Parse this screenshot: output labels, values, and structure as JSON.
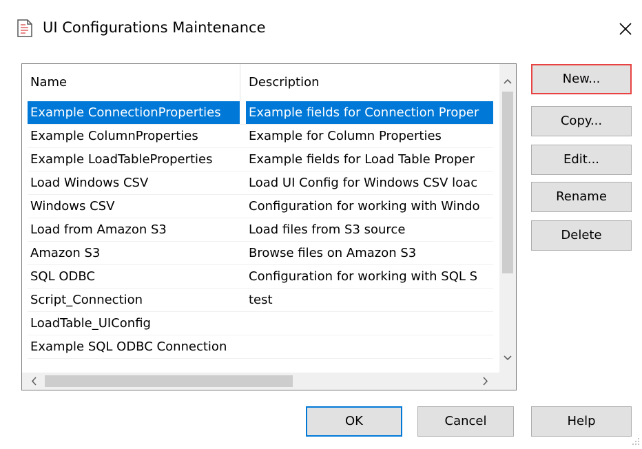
{
  "window": {
    "title": "UI Configurations Maintenance",
    "icon": "document-icon",
    "close_icon": "close-icon"
  },
  "list": {
    "columns": [
      "Name",
      "Description"
    ],
    "rows": [
      {
        "name": "Example ConnectionProperties",
        "description": "Example fields for Connection Proper",
        "selected": true
      },
      {
        "name": "Example ColumnProperties",
        "description": "Example for Column Properties",
        "selected": false
      },
      {
        "name": "Example LoadTableProperties",
        "description": "Example fields for Load Table Proper",
        "selected": false
      },
      {
        "name": "Load Windows CSV",
        "description": "Load UI Config for Windows CSV loac",
        "selected": false
      },
      {
        "name": "Windows CSV",
        "description": "Configuration for working with Windo",
        "selected": false
      },
      {
        "name": "Load from Amazon S3",
        "description": "Load files from S3 source",
        "selected": false
      },
      {
        "name": "Amazon S3",
        "description": "Browse files on Amazon S3",
        "selected": false
      },
      {
        "name": "SQL ODBC",
        "description": "Configuration for working with SQL S",
        "selected": false
      },
      {
        "name": "Script_Connection",
        "description": "test",
        "selected": false
      },
      {
        "name": "LoadTable_UIConfig",
        "description": "",
        "selected": false
      },
      {
        "name": "Example SQL ODBC Connection",
        "description": "",
        "selected": false
      }
    ]
  },
  "side_buttons": {
    "new": "New...",
    "copy": "Copy...",
    "edit": "Edit...",
    "rename": "Rename",
    "delete": "Delete"
  },
  "bottom_buttons": {
    "ok": "OK",
    "cancel": "Cancel",
    "help": "Help"
  },
  "colors": {
    "selection": "#0078d7",
    "highlight_border": "#e84343",
    "default_button_border": "#0078d7"
  }
}
